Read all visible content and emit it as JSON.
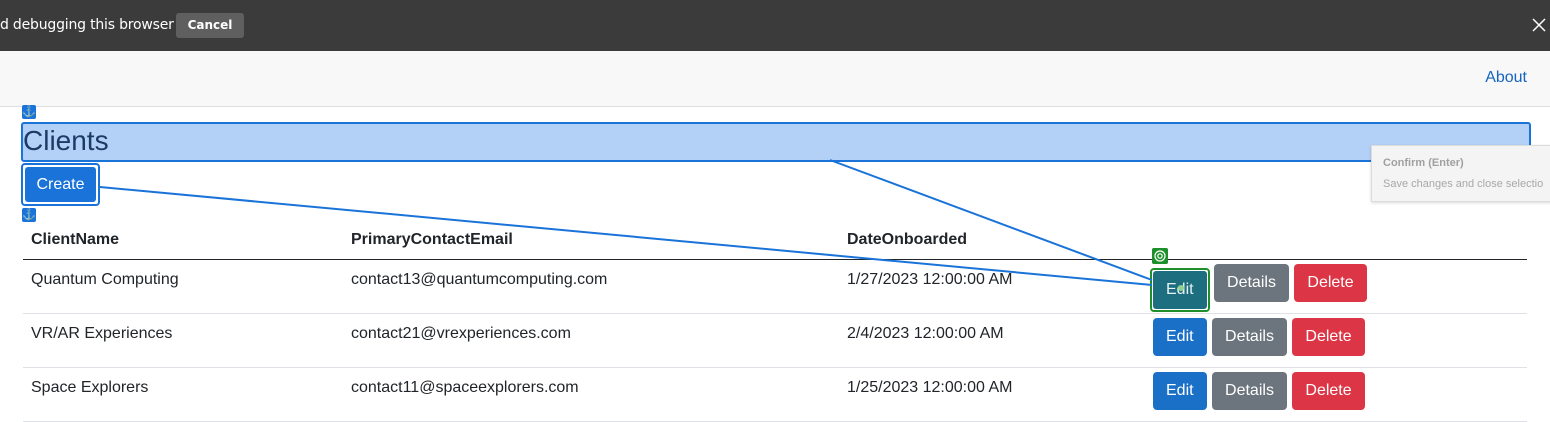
{
  "debug_bar": {
    "message": "d debugging this browser",
    "cancel_label": "Cancel"
  },
  "navbar": {
    "about_label": "About"
  },
  "page": {
    "title": "Clients",
    "create_label": "Create"
  },
  "tooltip": {
    "title": "Confirm (Enter)",
    "description": "Save changes and close selectio"
  },
  "table": {
    "headers": [
      "ClientName",
      "PrimaryContactEmail",
      "DateOnboarded",
      ""
    ],
    "rows": [
      {
        "name": "Quantum Computing",
        "email": "contact13@quantumcomputing.com",
        "date": "1/27/2023 12:00:00 AM"
      },
      {
        "name": "VR/AR Experiences",
        "email": "contact21@vrexperiences.com",
        "date": "2/4/2023 12:00:00 AM"
      },
      {
        "name": "Space Explorers",
        "email": "contact11@spaceexplorers.com",
        "date": "1/25/2023 12:00:00 AM"
      }
    ],
    "edit_label": "Edit",
    "details_label": "Details",
    "delete_label": "Delete"
  },
  "colors": {
    "accent": "#1a73d9",
    "edit": "#1a6fc7",
    "details": "#6c757d",
    "delete": "#dc3545",
    "target": "#1e8f2a"
  },
  "icons": [
    "anchor-icon",
    "target-icon",
    "close-icon"
  ]
}
